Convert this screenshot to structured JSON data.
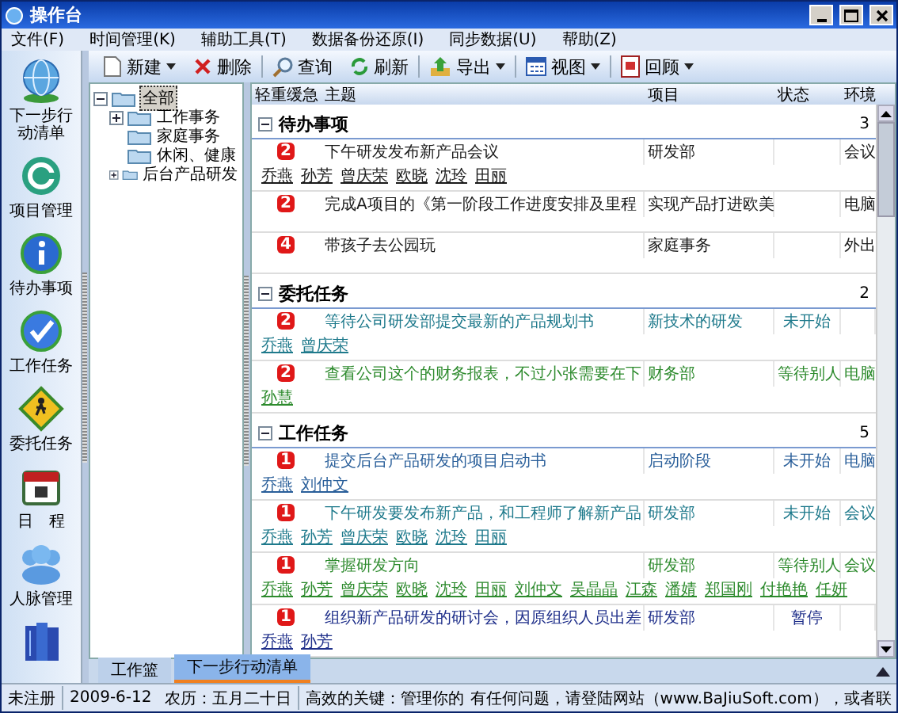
{
  "window": {
    "title": "操作台"
  },
  "menu": [
    {
      "label": "文件(F)"
    },
    {
      "label": "时间管理(K)"
    },
    {
      "label": "辅助工具(T)"
    },
    {
      "label": "数据备份还原(I)"
    },
    {
      "label": "同步数据(U)"
    },
    {
      "label": "帮助(Z)"
    }
  ],
  "nav": [
    {
      "kind": "labeled",
      "label": "下一步行动清单"
    },
    {
      "kind": "labeled",
      "label": "项目管理"
    },
    {
      "kind": "labeled",
      "label": "待办事项"
    },
    {
      "kind": "labeled",
      "label": "工作任务"
    },
    {
      "kind": "labeled",
      "label": "委托任务"
    },
    {
      "kind": "labeled",
      "label": "日　程"
    },
    {
      "kind": "labeled",
      "label": "人脉管理"
    },
    {
      "kind": "icon-only"
    }
  ],
  "toolbar": [
    {
      "label": "新建",
      "dropdown": true
    },
    {
      "label": "删除",
      "dropdown": false
    },
    {
      "label": "查询",
      "dropdown": false
    },
    {
      "label": "刷新",
      "dropdown": false
    },
    {
      "label": "导出",
      "dropdown": true
    },
    {
      "label": "视图",
      "dropdown": true
    },
    {
      "label": "回顾",
      "dropdown": true
    }
  ],
  "tree": {
    "label": "全部",
    "expanded": true,
    "selected": true,
    "children": [
      {
        "label": "工作事务",
        "expandable": true,
        "selected": false
      },
      {
        "label": "家庭事务",
        "expandable": false,
        "selected": false
      },
      {
        "label": "休闲、健康",
        "expandable": false,
        "selected": false
      },
      {
        "label": "后台产品研发",
        "expandable": true,
        "selected": false
      }
    ]
  },
  "table": {
    "columns": [
      "轻重缓急",
      "主题",
      "项目",
      "状态",
      "环境"
    ],
    "groups": [
      {
        "title": "待办事项",
        "count": "3",
        "expanded": true,
        "items": [
          {
            "priority": "2",
            "subject": "下午研发发布新产品会议",
            "project": "研发部",
            "context": "会议",
            "color": "#1a1a1a",
            "people": [
              "乔燕",
              "孙芳",
              "曾庆荣",
              "欧晓",
              "沈玲",
              "田丽"
            ]
          },
          {
            "priority": "2",
            "subject": "完成A项目的《第一阶段工作进度安排及里程",
            "project": "实现产品打进欧美",
            "context": "电脑",
            "color": "#1a1a1a"
          },
          {
            "priority": "4",
            "subject": "带孩子去公园玩",
            "project": "家庭事务",
            "context": "外出",
            "color": "#1a1a1a"
          }
        ]
      },
      {
        "title": "委托任务",
        "count": "2",
        "expanded": true,
        "items": [
          {
            "priority": "2",
            "subject": "等待公司研发部提交最新的产品规划书",
            "project": "新技术的研发",
            "status": "未开始",
            "color": "#1f7a8c",
            "people": [
              "乔燕",
              "曾庆荣"
            ]
          },
          {
            "priority": "2",
            "subject": "查看公司这个的财务报表，不过小张需要在下",
            "project": "财务部",
            "status": "等待别人",
            "context": "电脑",
            "color": "#2e8b2e",
            "people": [
              "孙慧"
            ]
          }
        ]
      },
      {
        "title": "工作任务",
        "count": "5",
        "expanded": true,
        "items": [
          {
            "priority": "1",
            "subject": "提交后台产品研发的项目启动书",
            "project": "启动阶段",
            "status": "未开始",
            "context": "电脑",
            "color": "#2a5f9a",
            "people": [
              "乔燕",
              "刘仲文"
            ]
          },
          {
            "priority": "1",
            "subject": "下午研发要发布新产品，和工程师了解新产品",
            "project": "研发部",
            "status": "未开始",
            "context": "会议",
            "color": "#1f7a8c",
            "people": [
              "乔燕",
              "孙芳",
              "曾庆荣",
              "欧晓",
              "沈玲",
              "田丽"
            ]
          },
          {
            "priority": "1",
            "subject": "掌握研发方向",
            "project": "研发部",
            "status": "等待别人",
            "context": "会议",
            "color": "#2e8b2e",
            "people": [
              "乔燕",
              "孙芳",
              "曾庆荣",
              "欧晓",
              "沈玲",
              "田丽",
              "刘仲文",
              "吴晶晶",
              "江森",
              "潘婧",
              "郑国刚",
              "付艳艳",
              "任妍"
            ]
          },
          {
            "priority": "1",
            "subject": "组织新产品研发的研讨会，因原组织人员出差",
            "project": "研发部",
            "status": "暂停",
            "color": "#1f2f8a",
            "people": [
              "乔燕",
              "孙芳"
            ]
          }
        ]
      }
    ]
  },
  "bottom_tabs": [
    {
      "label": "工作篮",
      "selected": false
    },
    {
      "label": "下一步行动清单",
      "selected": true
    }
  ],
  "status_bar": {
    "registration": "未注册",
    "date": "2009-6-12",
    "lunar": "农历：五月二十日",
    "tip": "高效的关键：管理你的",
    "message": "有任何问题，请登陆网站（www.BaJiuSoft.com），或者联"
  }
}
